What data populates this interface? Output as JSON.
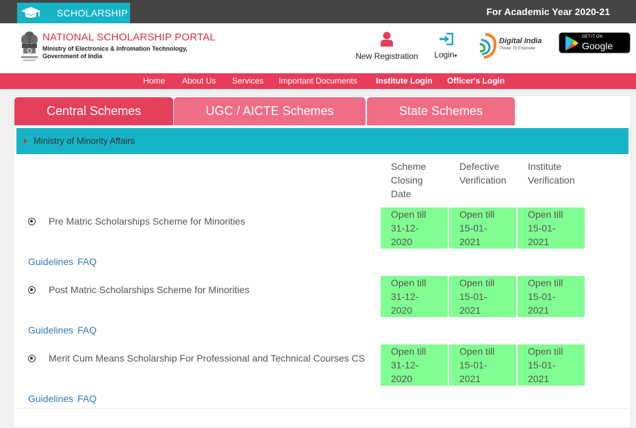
{
  "topbar": {
    "brand_label": "SCHOLARSHIP",
    "academic_year": "For Academic Year 2020-21",
    "brand_color": "#17b3c7"
  },
  "header": {
    "portal_name": "NATIONAL SCHOLARSHIP PORTAL",
    "ministry_line1": "Ministry of Electronics & Infromation Technology,",
    "ministry_line2": "Government of India",
    "new_registration": "New Registration",
    "login": "Login",
    "digital_india_title": "Digital India",
    "digital_india_tagline": "Power To Empower",
    "google_play_top": "GET IT ON",
    "google_play_name": "Google Play"
  },
  "nav": {
    "items": [
      {
        "label": "Home"
      },
      {
        "label": "About Us"
      },
      {
        "label": "Services"
      },
      {
        "label": "Important Documents"
      },
      {
        "label": "Institute Login"
      },
      {
        "label": "Officer's Login"
      }
    ],
    "color": "#e73d5a"
  },
  "tabs": [
    {
      "label": "Central Schemes",
      "active": true
    },
    {
      "label": "UGC / AICTE Schemes",
      "active": false
    },
    {
      "label": "State Schemes",
      "active": false
    }
  ],
  "ministry_section": {
    "title": "Ministry of Minority Affairs"
  },
  "columns": {
    "closing_line1": "Scheme",
    "closing_line2": "Closing",
    "closing_line3": "Date",
    "defective_line1": "Defective",
    "defective_line2": "Verification",
    "institute_line1": "Institute",
    "institute_line2": "Verification"
  },
  "schemes": [
    {
      "name": "Pre Matric Scholarships Scheme for Minorities",
      "closing": [
        "Open till",
        "31-12-",
        "2020"
      ],
      "defective": [
        "Open till",
        "15-01-",
        "2021"
      ],
      "institute": [
        "Open till",
        "15-01-",
        "2021"
      ],
      "guidelines": "Guidelines",
      "faq": "FAQ"
    },
    {
      "name": "Post Matric Scholarships Scheme for Minorities",
      "closing": [
        "Open till",
        "31-12-",
        "2020"
      ],
      "defective": [
        "Open till",
        "15-01-",
        "2021"
      ],
      "institute": [
        "Open till",
        "15-01-",
        "2021"
      ],
      "guidelines": "Guidelines",
      "faq": "FAQ"
    },
    {
      "name": "Merit Cum Means Scholarship For Professional and Technical Courses CS",
      "closing": [
        "Open till",
        "31-12-",
        "2020"
      ],
      "defective": [
        "Open till",
        "15-01-",
        "2021"
      ],
      "institute": [
        "Open till",
        "15-01-",
        "2021"
      ],
      "guidelines": "Guidelines",
      "faq": "FAQ"
    }
  ],
  "colors": {
    "status_cell": "#80fe91",
    "link": "#337ab7"
  }
}
